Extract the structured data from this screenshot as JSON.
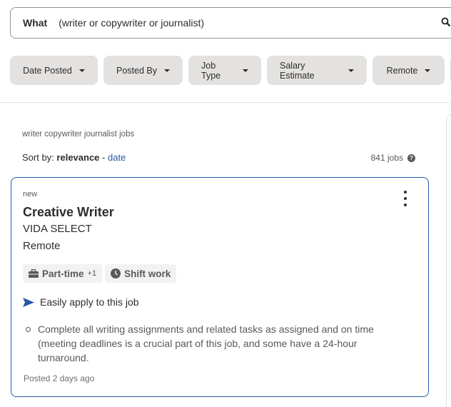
{
  "search": {
    "label": "What",
    "value": "(writer or copywriter or journalist)",
    "icon": "search-icon"
  },
  "filters": [
    "Date Posted",
    "Posted By",
    "Job Type",
    "Salary Estimate",
    "Remote"
  ],
  "results": {
    "heading": "writer copywriter journalist jobs",
    "sort_prefix": "Sort by:",
    "sort_active": "relevance",
    "sort_sep": "-",
    "sort_other": "date",
    "count": "841 jobs"
  },
  "job": {
    "badge": "new",
    "title": "Creative Writer",
    "company": "VIDA SELECT",
    "location": "Remote",
    "tags": [
      {
        "label": "Part-time",
        "extra": "+1",
        "icon": "briefcase-icon"
      },
      {
        "label": "Shift work",
        "icon": "clock-icon"
      }
    ],
    "apply": "Easily apply to this job",
    "snippet": "Complete all writing assignments and related tasks as assigned and on time (meeting deadlines is a crucial part of this job, and some have a 24-hour turnaround.",
    "posted": "Posted 2 days ago"
  },
  "colors": {
    "accent": "#2557a7",
    "chip": "#e4e2e0"
  }
}
